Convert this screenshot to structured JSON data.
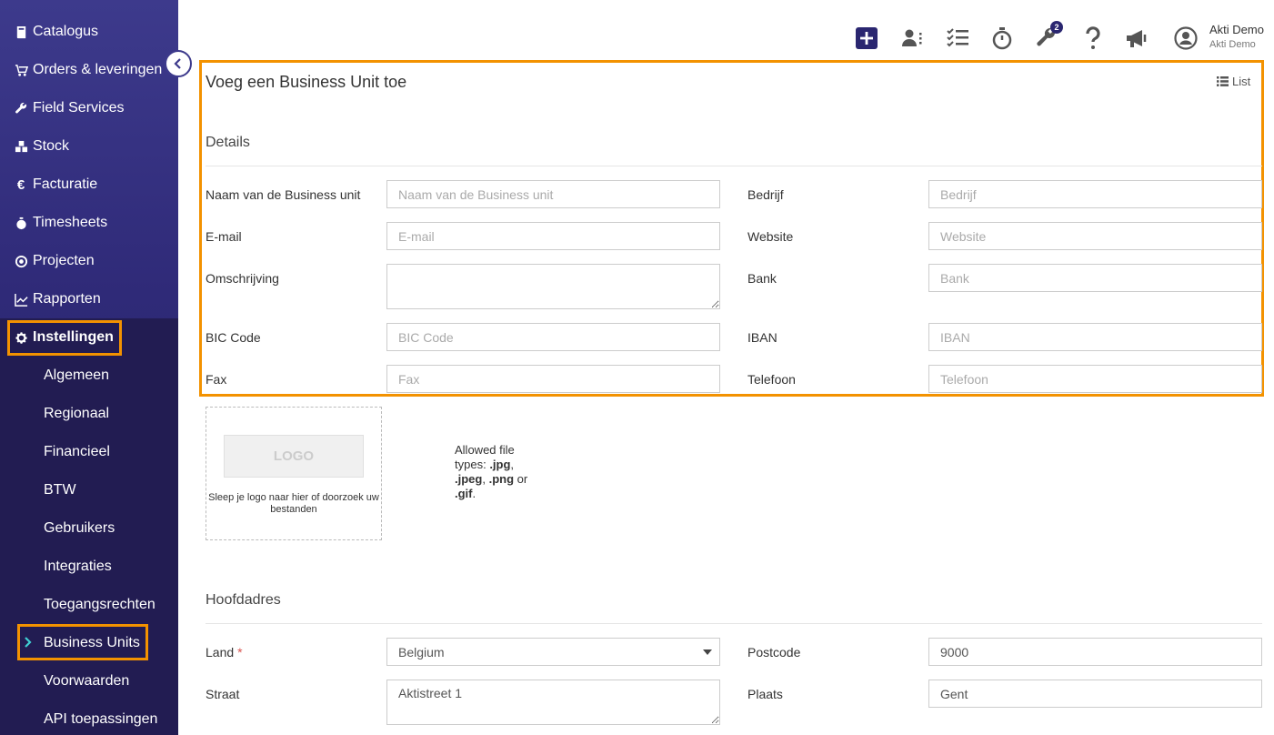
{
  "sidebar": {
    "items": [
      {
        "label": "Catalogus",
        "icon": "book-icon"
      },
      {
        "label": "Orders & leveringen",
        "icon": "cart-icon"
      },
      {
        "label": "Field Services",
        "icon": "wrench-icon"
      },
      {
        "label": "Stock",
        "icon": "cubes-icon"
      },
      {
        "label": "Facturatie",
        "icon": "euro-icon"
      },
      {
        "label": "Timesheets",
        "icon": "stopwatch-icon"
      },
      {
        "label": "Projecten",
        "icon": "target-icon"
      },
      {
        "label": "Rapporten",
        "icon": "chart-icon"
      }
    ],
    "settings": {
      "label": "Instellingen",
      "icon": "gear-icon"
    },
    "sub_items": [
      "Algemeen",
      "Regionaal",
      "Financieel",
      "BTW",
      "Gebruikers",
      "Integraties",
      "Toegangsrechten",
      "Business Units",
      "Voorwaarden",
      "API toepassingen"
    ],
    "active_sub": "Business Units"
  },
  "topbar": {
    "badge_count": "2",
    "user_name": "Akti Demo",
    "user_company": "Akti Demo"
  },
  "form": {
    "title": "Voeg een Business Unit toe",
    "list_label": "List",
    "details_title": "Details",
    "name_label": "Naam van de Business unit",
    "name_placeholder": "Naam van de Business unit",
    "company_label": "Bedrijf",
    "company_placeholder": "Bedrijf",
    "email_label": "E-mail",
    "email_placeholder": "E-mail",
    "website_label": "Website",
    "website_placeholder": "Website",
    "description_label": "Omschrijving",
    "bank_label": "Bank",
    "bank_placeholder": "Bank",
    "bic_label": "BIC Code",
    "bic_placeholder": "BIC Code",
    "iban_label": "IBAN",
    "iban_placeholder": "IBAN",
    "fax_label": "Fax",
    "fax_placeholder": "Fax",
    "phone_label": "Telefoon",
    "phone_placeholder": "Telefoon",
    "logo_text": "LOGO",
    "logo_hint": "Sleep je logo naar hier of doorzoek uw bestanden",
    "allowed_prefix": "Allowed file types:",
    "allowed_jpg": ".jpg",
    "allowed_jpeg": ".jpeg",
    "allowed_png": ".png",
    "allowed_or": "or",
    "allowed_gif": ".gif",
    "address_title": "Hoofdadres",
    "country_label": "Land",
    "country_required": "*",
    "country_value": "Belgium",
    "postcode_label": "Postcode",
    "postcode_value": "9000",
    "street_label": "Straat",
    "street_value": "Aktistreet 1",
    "city_label": "Plaats",
    "city_value": "Gent"
  },
  "colors": {
    "accent": "#f39200",
    "sidebar": "#2f2a78",
    "sidebar_sub": "#221c52"
  }
}
